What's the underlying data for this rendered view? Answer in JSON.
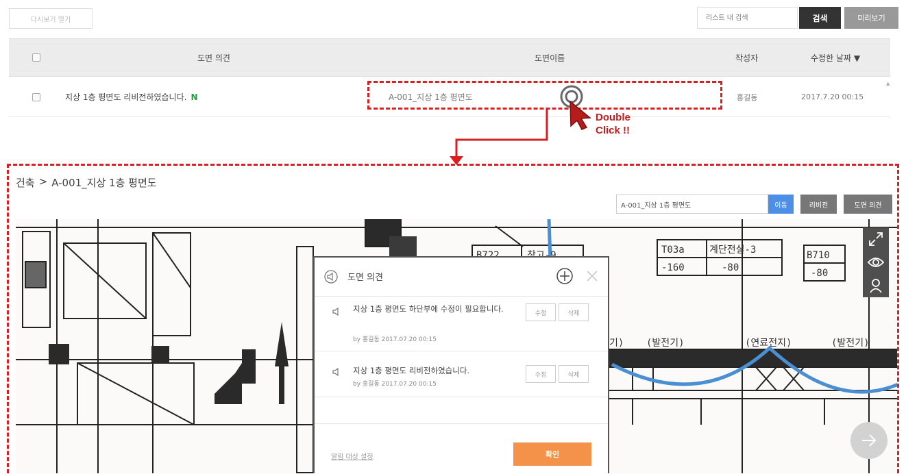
{
  "toolbar": {
    "reopen_label": "다시보기 열기",
    "search_placeholder": "리스트 내 검색",
    "search_label": "검색",
    "preview_label": "미리보기"
  },
  "list": {
    "headers": {
      "opinion": "도면 의견",
      "sheet_name": "도면이름",
      "author": "작성자",
      "modified": "수정한 날짜 ▼"
    },
    "rows": [
      {
        "opinion": "지상 1층 평면도 리비전하였습니다.",
        "badge": "N",
        "sheet_name": "A-001_지상 1층 평면도",
        "author": "홍길동",
        "modified": "2017.7.20 00:15"
      }
    ]
  },
  "annotation": {
    "line1": "Double",
    "line2": "Click !!",
    "color": "#d91f1f"
  },
  "detail": {
    "breadcrumb": [
      "건축",
      ">",
      "A-001_지상 1층 평면도"
    ],
    "sheet_value": "A-001_지상 1층 평면도",
    "move_label": "이동",
    "revision_label": "리비전",
    "opinion_label": "도면 의견"
  },
  "drawing_labels": {
    "b722": "B722",
    "storage9": "창고-9",
    "t03a": "T03a",
    "stair3": "계단전실-3",
    "b710": "B710",
    "minus160": "-160",
    "minus80a": "-80",
    "minus80b": "-80",
    "gen_partial": "기)",
    "gen1": "(발전기)",
    "fuel": "(연료전지)",
    "gen2": "(발전기)"
  },
  "popup": {
    "title": "도면 의견",
    "comments": [
      {
        "text": "지상 1층 평면도 하단부에 수정이 필요합니다.",
        "meta": "by 홍길동 2017.07.20 00:15",
        "edit": "수정",
        "delete": "삭제"
      },
      {
        "text": "지상 1층 평면도 리비전하였습니다.",
        "meta": "by 홍길동 2017.07.20 00:15",
        "edit": "수정",
        "delete": "삭제"
      }
    ],
    "notify_link": "알림 대상 설정",
    "confirm_label": "확인"
  },
  "colors": {
    "accent_red": "#d91f1f",
    "search_button": "#333333",
    "move_button": "#4d8fe6",
    "confirm_button": "#f39248",
    "new_badge": "#1aa33b",
    "pipe_blue": "#4a8fd1"
  }
}
